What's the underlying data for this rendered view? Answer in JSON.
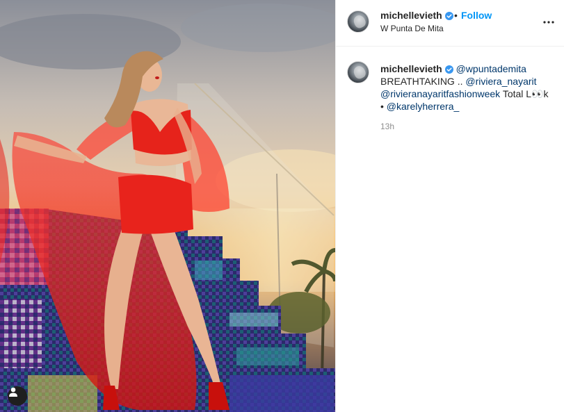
{
  "post": {
    "username": "michellevieth",
    "verified": true,
    "follow_label": "Follow",
    "dot": "•",
    "location": "W Punta De Mita"
  },
  "caption": {
    "username": "michellevieth",
    "mention_1": "@wpuntademita",
    "text_1": "BREATHTAKING ..",
    "mention_2": "@riviera_nayarit",
    "mention_3": "@rivieranayaritfashionweek",
    "text_2": "Total L👀k •",
    "mention_4": "@karelyherrera_",
    "time": "13h"
  },
  "icons": {
    "verified": "verified-badge-icon",
    "more": "more-options-icon",
    "user_tag": "person-icon"
  },
  "colors": {
    "follow": "#0095f6",
    "mention": "#00376b",
    "verified": "#3897f0",
    "dress": "#e8231c",
    "muted_text": "#8e8e8e"
  }
}
